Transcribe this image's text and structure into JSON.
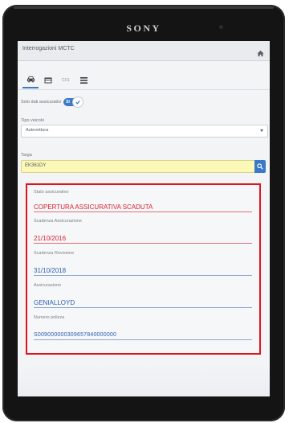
{
  "device": {
    "brand": "SONY"
  },
  "header": {
    "title": "Interrogazioni MCTC",
    "home_icon": "home-icon"
  },
  "tabs": [
    {
      "icon": "car-icon",
      "active": true
    },
    {
      "icon": "card-icon",
      "active": false
    },
    {
      "label": "CIG",
      "active": false
    },
    {
      "icon": "list-icon",
      "active": false
    }
  ],
  "insured_toggle": {
    "label": "Solo dati assicurativi",
    "on_label": "SI",
    "checked": true
  },
  "vehicle_type": {
    "label": "Tipo veicolo",
    "value": "Autovettura"
  },
  "plate": {
    "label": "Targa",
    "value": "EK361DY"
  },
  "results": {
    "insurance_status_label": "Stato assicurativo",
    "insurance_status_value": "COPERTURA ASSICURATIVA SCADUTA",
    "insurance_expiry_label": "Scadenza Assicurazione",
    "insurance_expiry_value": "21/10/2016",
    "revision_expiry_label": "Scadenza Revisione",
    "revision_expiry_value": "31/10/2018",
    "insurer_label": "Assicurazione",
    "insurer_value": "GENIALLOYD",
    "policy_number_label": "Numero polizza",
    "policy_number_value": "S009000000309657840000000"
  },
  "colors": {
    "accent": "#3a78c8",
    "alert": "#e0141e",
    "plate_bg": "#fcf8b7"
  }
}
